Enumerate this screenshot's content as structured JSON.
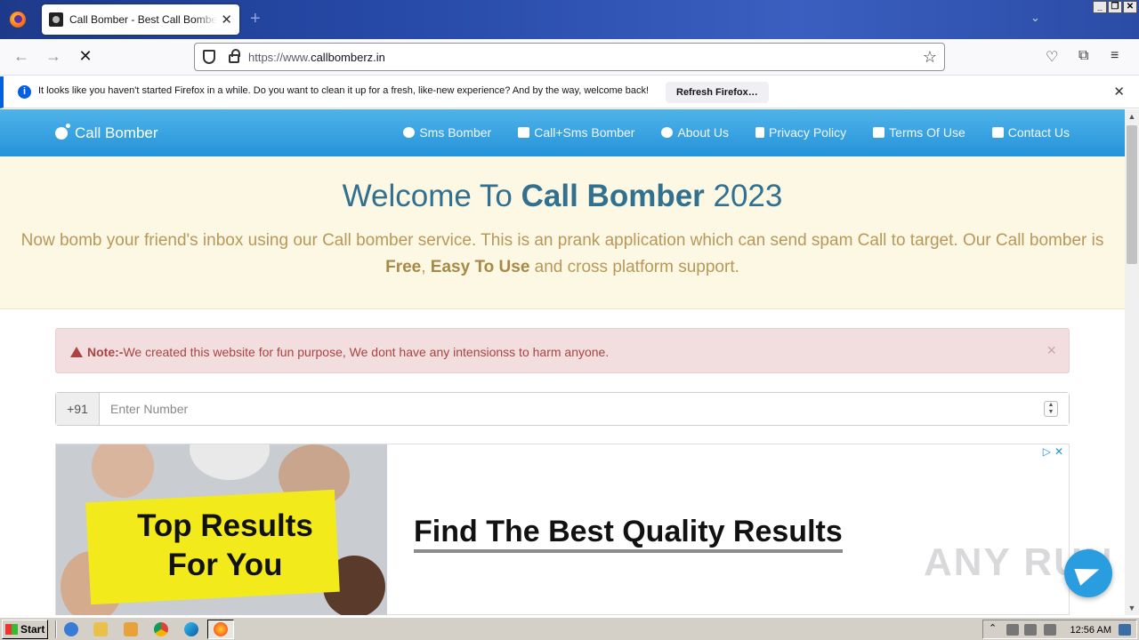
{
  "browser": {
    "tab_title": "Call Bomber - Best Call Bomber Online",
    "url_prefix": "https://www.",
    "url_domain": "callbomberz.in",
    "notification_text": "It looks like you haven't started Firefox in a while. Do you want to clean it up for a fresh, like-new experience? And by the way, welcome back!",
    "notification_button": "Refresh Firefox…",
    "window_buttons": [
      "_",
      "❐",
      "✕"
    ]
  },
  "site": {
    "brand": "Call Bomber",
    "menu": [
      {
        "label": "Sms Bomber",
        "icon": "bomb-icon"
      },
      {
        "label": "Call+Sms Bomber",
        "icon": "paper-plane-icon"
      },
      {
        "label": "About Us",
        "icon": "info-icon"
      },
      {
        "label": "Privacy Policy",
        "icon": "document-icon"
      },
      {
        "label": "Terms Of Use",
        "icon": "list-icon"
      },
      {
        "label": "Contact Us",
        "icon": "envelope-icon"
      }
    ],
    "hero": {
      "title_pre": "Welcome To ",
      "title_bold": "Call Bomber",
      "title_post": " 2023",
      "desc_1": "Now bomb your friend's inbox using our Call bomber service. This is an prank application which can send spam Call to target. Our Call bomber is ",
      "desc_free": "Free",
      "desc_comma": ", ",
      "desc_easy": "Easy To Use",
      "desc_2": " and cross platform support."
    },
    "alert": {
      "label": "Note:-",
      "text": " We created this website for fun purpose, We dont have any intensionss to harm anyone.",
      "close": "×"
    },
    "phone": {
      "prefix": "+91",
      "placeholder": "Enter Number"
    },
    "ad": {
      "image_headline_1": "Top Results",
      "image_headline_2": "For You",
      "title": "Find The Best Quality Results"
    },
    "watermark": "ANY RUN"
  },
  "taskbar": {
    "start_label": "Start",
    "clock": "12:56 AM"
  },
  "colors": {
    "nav_blue": "#2593d9",
    "hero_bg": "#fcf8e3",
    "hero_title": "#31708f",
    "alert_bg": "#f2dede",
    "alert_text": "#a94442"
  }
}
